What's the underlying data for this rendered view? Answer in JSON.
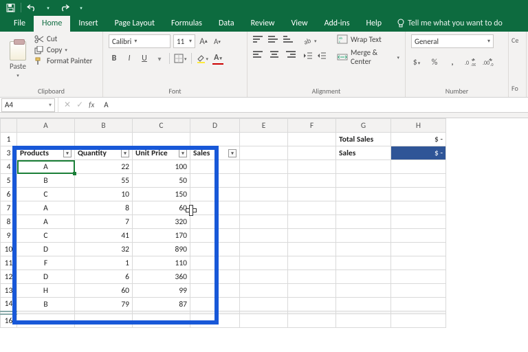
{
  "qat": {
    "save": "save-icon",
    "undo": "undo-icon",
    "redo": "redo-icon"
  },
  "tabs": {
    "file": "File",
    "home": "Home",
    "insert": "Insert",
    "page_layout": "Page Layout",
    "formulas": "Formulas",
    "data": "Data",
    "review": "Review",
    "view": "View",
    "addins": "Add-ins",
    "help": "Help",
    "tell_me": "Tell me what you want to do"
  },
  "ribbon": {
    "clipboard": {
      "paste": "Paste",
      "cut": "Cut",
      "copy": "Copy",
      "format_painter": "Format Painter",
      "label": "Clipboard"
    },
    "font": {
      "name": "Calibri",
      "size": "11",
      "bold": "B",
      "italic": "I",
      "underline": "U",
      "label": "Font"
    },
    "alignment": {
      "wrap": "Wrap Text",
      "merge": "Merge & Center",
      "label": "Alignment"
    },
    "number": {
      "format": "General",
      "label": "Number"
    },
    "cells_hint": "Ce",
    "format_hint": "Fo"
  },
  "namebox": "A4",
  "formula_prefix": "fx",
  "formula_value": "A",
  "columns": [
    "A",
    "B",
    "C",
    "D",
    "E",
    "F",
    "G",
    "H"
  ],
  "rows_before_skip": [
    "1",
    "3",
    "4",
    "5",
    "6",
    "7",
    "8",
    "9",
    "10",
    "11",
    "12",
    "13",
    "14"
  ],
  "row_after_skip": "16",
  "summary": {
    "total_sales_label": "Total Sales",
    "total_sales_value": "$          -",
    "sales_label": "Sales",
    "sales_value": "$          -"
  },
  "table": {
    "headers": {
      "products": "Products",
      "quantity": "Quantity",
      "unit_price": "Unit Price",
      "sales": "Sales"
    },
    "rows": [
      {
        "p": "A",
        "q": "22",
        "u": "100"
      },
      {
        "p": "B",
        "q": "55",
        "u": "50"
      },
      {
        "p": "C",
        "q": "10",
        "u": "150"
      },
      {
        "p": "A",
        "q": "8",
        "u": "60"
      },
      {
        "p": "A",
        "q": "7",
        "u": "320"
      },
      {
        "p": "C",
        "q": "41",
        "u": "170"
      },
      {
        "p": "D",
        "q": "32",
        "u": "890"
      },
      {
        "p": "F",
        "q": "1",
        "u": "110"
      },
      {
        "p": "D",
        "q": "6",
        "u": "360"
      },
      {
        "p": "H",
        "q": "60",
        "u": "99"
      },
      {
        "p": "B",
        "q": "79",
        "u": "87"
      }
    ]
  }
}
